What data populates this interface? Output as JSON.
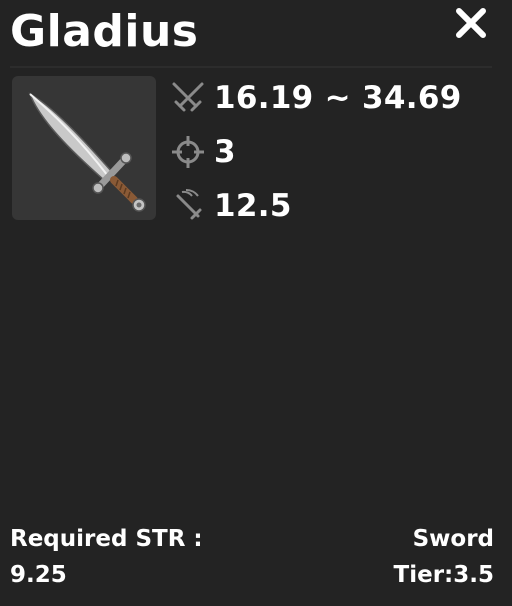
{
  "item": {
    "name": "Gladius",
    "image_icon": "sword-icon"
  },
  "stats": {
    "damage": {
      "icon": "crossed-swords-icon",
      "value": "16.19 ~ 34.69"
    },
    "range": {
      "icon": "crosshair-icon",
      "value": "3"
    },
    "speed": {
      "icon": "swift-sword-icon",
      "value": "12.5"
    }
  },
  "requirement": {
    "label": "Required STR :",
    "value": "9.25"
  },
  "type": "Sword",
  "tier": "Tier:3.5",
  "close_icon": "close-icon",
  "colors": {
    "background": "#232323",
    "frame": "#363636",
    "text": "#ffffff",
    "icon_muted": "#8a8a8a"
  }
}
